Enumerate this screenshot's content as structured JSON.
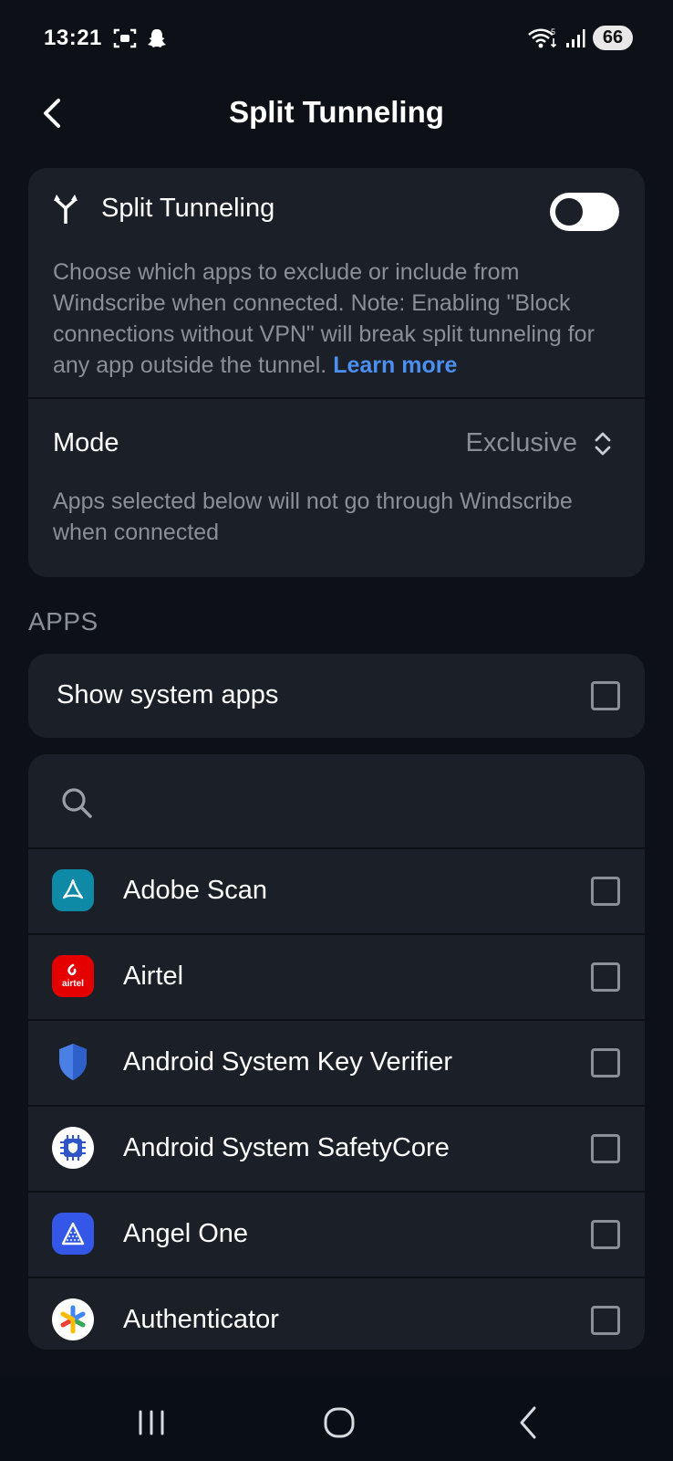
{
  "status": {
    "time": "13:21",
    "battery": "66"
  },
  "header": {
    "title": "Split Tunneling"
  },
  "split": {
    "label": "Split Tunneling",
    "description": "Choose which apps to exclude or include from Windscribe when connected. Note: Enabling \"Block connections without VPN\" will break split tunneling for any app outside the tunnel.",
    "learn_more": "Learn more",
    "enabled": false
  },
  "mode": {
    "label": "Mode",
    "value": "Exclusive",
    "description": "Apps selected below will not go through Windscribe when connected"
  },
  "apps_section": {
    "title": "APPS"
  },
  "system_apps": {
    "label": "Show system apps",
    "checked": false
  },
  "search": {
    "icon": "search-icon"
  },
  "apps": [
    {
      "name": "Adobe Scan",
      "icon": "adobe-scan-icon",
      "color": "#0e8aa6",
      "checked": false
    },
    {
      "name": "Airtel",
      "icon": "airtel-icon",
      "color": "#e40000",
      "checked": false
    },
    {
      "name": "Android System Key Verifier",
      "icon": "shield-icon",
      "color": "#4a7fe6",
      "checked": false
    },
    {
      "name": "Android System SafetyCore",
      "icon": "safetycore-icon",
      "color": "#ffffff",
      "checked": false
    },
    {
      "name": "Angel One",
      "icon": "angel-one-icon",
      "color": "#3557e8",
      "checked": false
    },
    {
      "name": "Authenticator",
      "icon": "authenticator-icon",
      "color": "#ffffff",
      "checked": false
    }
  ],
  "colors": {
    "background": "#0d1117",
    "card": "#1b1f27",
    "accent": "#4b8ff0",
    "muted": "#8a8f98"
  }
}
